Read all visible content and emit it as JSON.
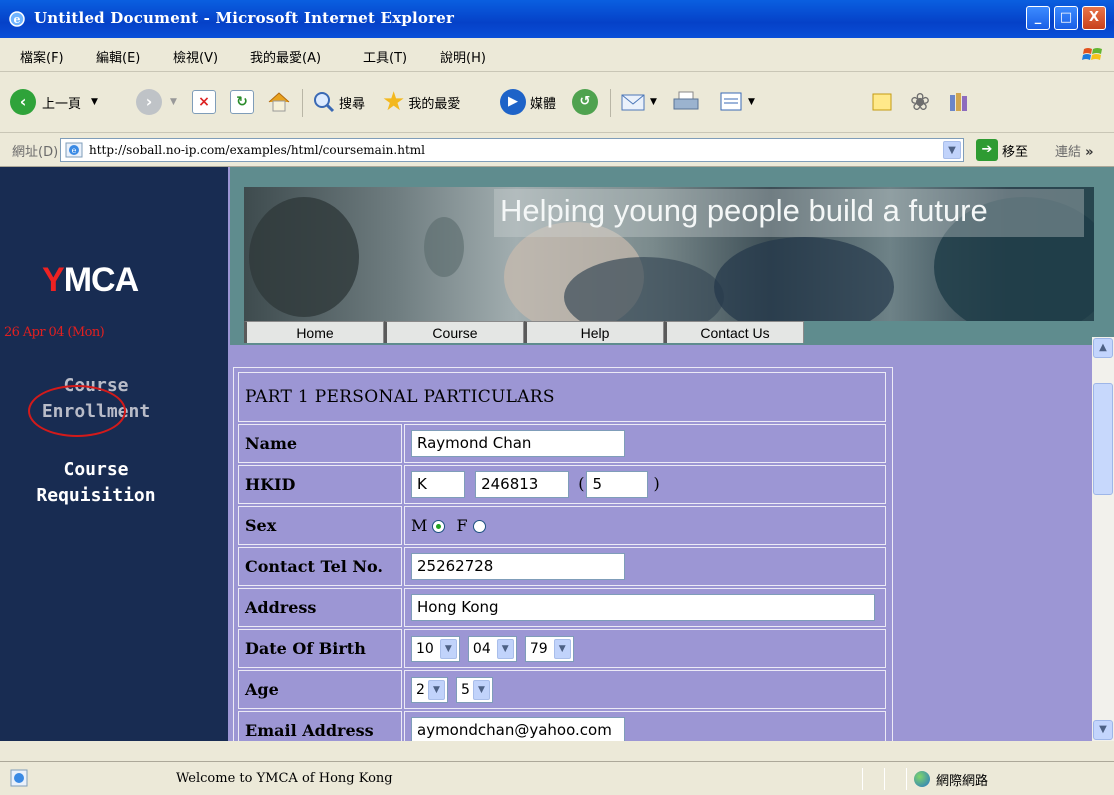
{
  "window": {
    "title": "Untitled Document - Microsoft Internet Explorer",
    "controls": {
      "minimize": "_",
      "maximize": "□",
      "close": "X"
    }
  },
  "menu": [
    "檔案(F)",
    "編輯(E)",
    "檢視(V)",
    "我的最愛(A)",
    "工具(T)",
    "說明(H)"
  ],
  "toolbar": {
    "back_label": "上一頁",
    "search_label": "搜尋",
    "favorites_label": "我的最愛",
    "media_label": "媒體"
  },
  "address_bar": {
    "label": "網址(D)",
    "url": "http://soball.no-ip.com/examples/html/coursemain.html",
    "go_label": "移至",
    "links_label": "連結"
  },
  "page": {
    "logo": {
      "text": "MCA",
      "accent": "Y"
    },
    "date": "26 Apr 04 (Mon)",
    "nav": {
      "enrollment_line1": "Course",
      "enrollment_line2": "Enrollment",
      "requisition_line1": "Course",
      "requisition_line2": "Requisition"
    },
    "banner_text": "Helping young people build a future",
    "tabs": [
      "Home",
      "Course",
      "Help",
      "Contact Us"
    ],
    "form": {
      "section_title": "PART 1 PERSONAL PARTICULARS",
      "fields": {
        "name": {
          "label": "Name",
          "value": "Raymond Chan"
        },
        "hkid": {
          "label": "HKID",
          "prefix": "K",
          "number": "246813",
          "open_paren": "(",
          "check": "5",
          "close_paren": ")"
        },
        "sex": {
          "label": "Sex",
          "option_m": "M",
          "option_f": "F",
          "selected": "M"
        },
        "tel": {
          "label": "Contact Tel No.",
          "value": "25262728"
        },
        "address": {
          "label": "Address",
          "value": "Hong Kong"
        },
        "dob": {
          "label": "Date Of Birth",
          "day": "10",
          "month": "04",
          "year": "79"
        },
        "age": {
          "label": "Age",
          "tens": "2",
          "units": "5"
        },
        "email": {
          "label": "Email Address",
          "value": "aymondchan@yahoo.com"
        }
      }
    }
  },
  "status_bar": {
    "message": "Welcome to YMCA of Hong Kong",
    "zone": "網際網路"
  },
  "colors": {
    "title_bar": "#0A5FE0",
    "left_panel": "#182C52",
    "page_bg": "#9C96D4",
    "banner_bg": "#5F8C8E",
    "date_red": "#E02020",
    "annotation_circle": "#D31A1A"
  }
}
